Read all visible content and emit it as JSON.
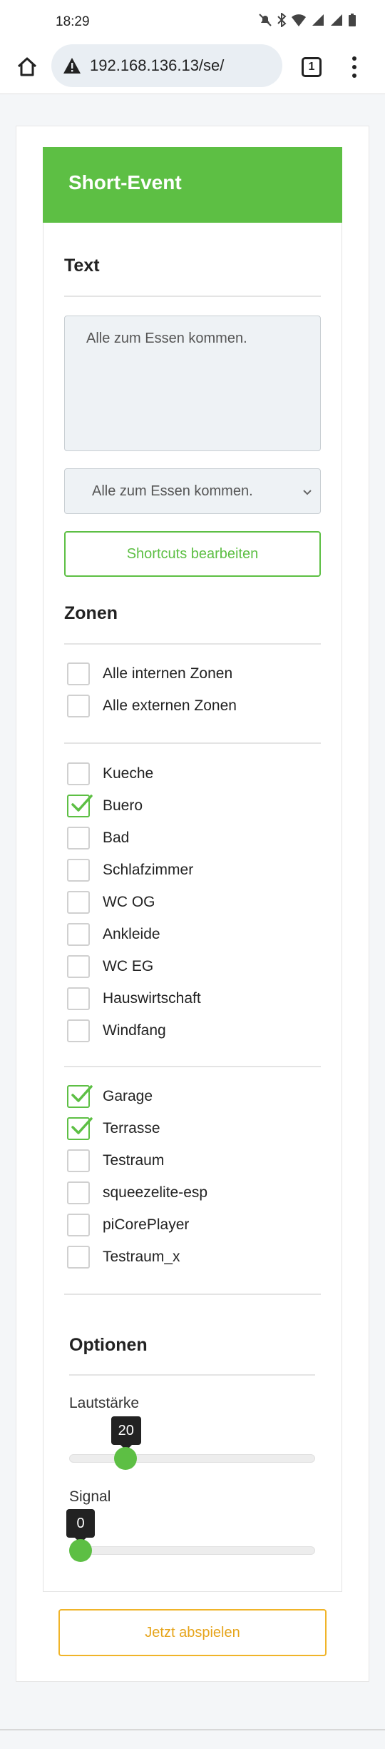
{
  "status": {
    "time": "18:29"
  },
  "browser": {
    "url": "192.168.136.13/se/",
    "tab_count": "1"
  },
  "header": {
    "title": "Short-Event"
  },
  "text_section": {
    "title": "Text",
    "textarea_value": "Alle zum Essen kommen.",
    "select_value": "Alle zum Essen kommen.",
    "shortcuts_button": "Shortcuts bearbeiten"
  },
  "zones_section": {
    "title": "Zonen",
    "group_all": [
      {
        "label": "Alle internen Zonen",
        "checked": false
      },
      {
        "label": "Alle externen Zonen",
        "checked": false
      }
    ],
    "group_internal": [
      {
        "label": "Kueche",
        "checked": false
      },
      {
        "label": "Buero",
        "checked": true
      },
      {
        "label": "Bad",
        "checked": false
      },
      {
        "label": "Schlafzimmer",
        "checked": false
      },
      {
        "label": "WC OG",
        "checked": false
      },
      {
        "label": "Ankleide",
        "checked": false
      },
      {
        "label": "WC EG",
        "checked": false
      },
      {
        "label": "Hauswirtschaft",
        "checked": false
      },
      {
        "label": "Windfang",
        "checked": false
      }
    ],
    "group_external": [
      {
        "label": "Garage",
        "checked": true
      },
      {
        "label": "Terrasse",
        "checked": true
      },
      {
        "label": "Testraum",
        "checked": false
      },
      {
        "label": "squeezelite-esp",
        "checked": false
      },
      {
        "label": "piCorePlayer",
        "checked": false
      },
      {
        "label": "Testraum_x",
        "checked": false
      }
    ]
  },
  "options_section": {
    "title": "Optionen",
    "volume": {
      "label": "Lautstärke",
      "value": "20",
      "fraction": 0.2
    },
    "signal": {
      "label": "Signal",
      "value": "0",
      "fraction": 0.0
    }
  },
  "play_button": "Jetzt abspielen",
  "colors": {
    "accent_green": "#5dbf44",
    "accent_orange": "#f0b429"
  }
}
